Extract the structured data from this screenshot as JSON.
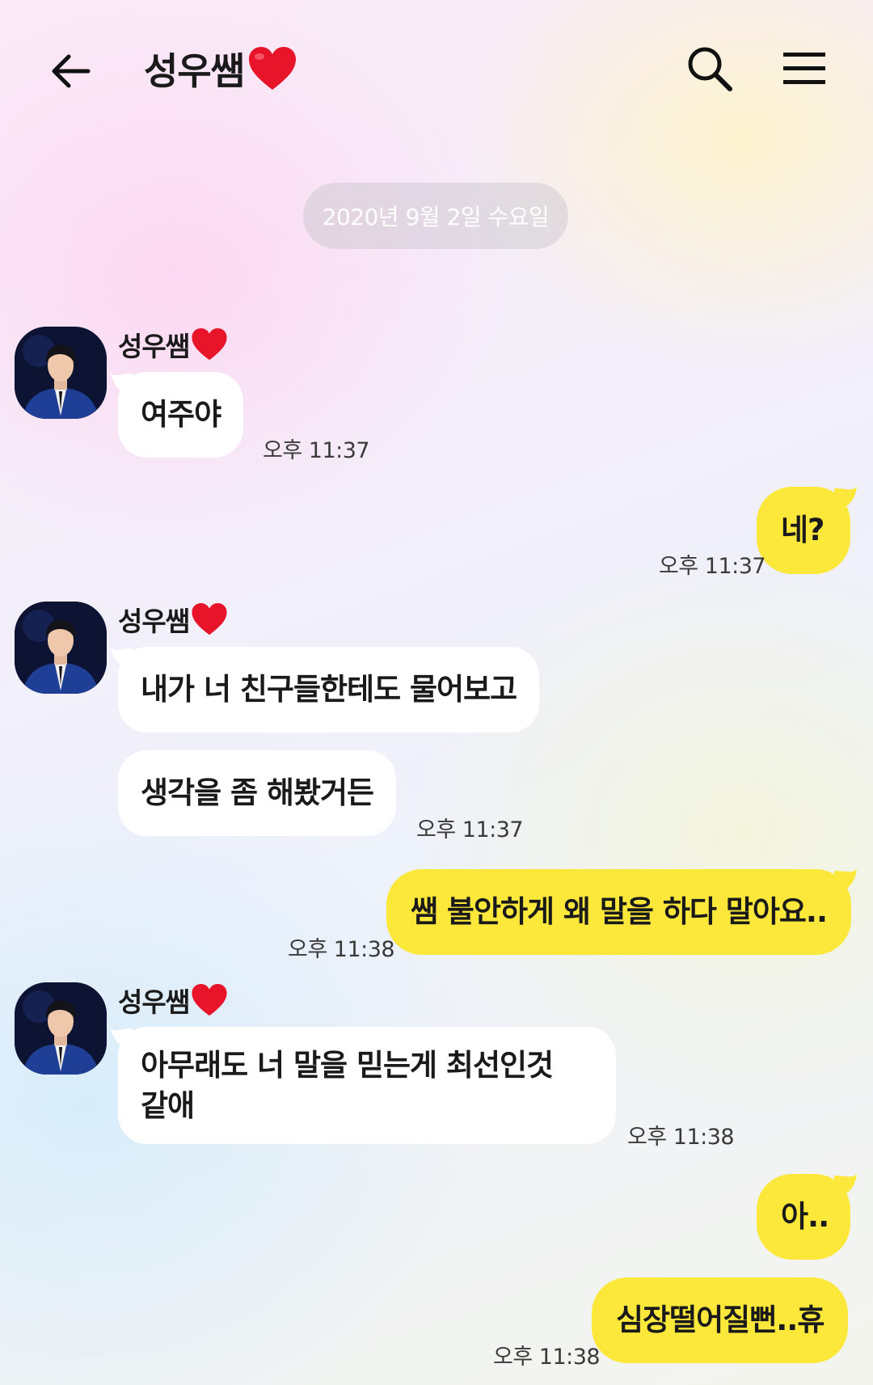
{
  "header": {
    "title": "성우쌤",
    "back_icon": "arrow-left-icon",
    "search_icon": "search-icon",
    "menu_icon": "hamburger-menu-icon",
    "heart_color": "#e8142a"
  },
  "date_divider": "2020년 9월 2일 수요일",
  "sender": {
    "name": "성우쌤",
    "avatar": "profile-photo"
  },
  "messages": [
    {
      "direction": "in",
      "text": "여주야",
      "time": "오후 11:37"
    },
    {
      "direction": "out",
      "text": "네?",
      "time": "오후 11:37"
    },
    {
      "direction": "in",
      "text": "내가 너 친구들한테도 물어보고",
      "time": ""
    },
    {
      "direction": "in",
      "text": "생각을 좀 해봤거든",
      "time": "오후 11:37"
    },
    {
      "direction": "out",
      "text": "쌤 불안하게 왜 말을 하다 말아요..",
      "time": "오후 11:38"
    },
    {
      "direction": "in",
      "text": "아무래도 너 말을 믿는게 최선인것\n같애",
      "time": "오후 11:38"
    },
    {
      "direction": "out",
      "text": "아..",
      "time": ""
    },
    {
      "direction": "out",
      "text": "심장떨어질뻔..휴",
      "time": "오후 11:38"
    }
  ],
  "colors": {
    "outgoing_bubble": "#fbe83a",
    "incoming_bubble": "#ffffff"
  }
}
